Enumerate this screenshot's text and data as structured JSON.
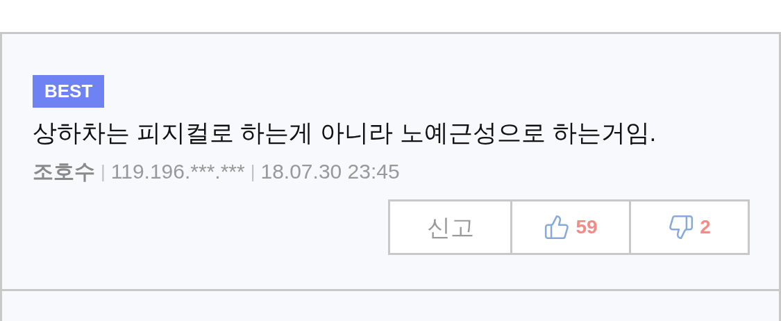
{
  "comment": {
    "badge": "BEST",
    "text": "상하차는 피지컬로 하는게 아니라 노예근성으로 하는거임.",
    "author": "조호수",
    "ip": "119.196.***.***",
    "date": "18.07.30 23:45",
    "separator": "|",
    "actions": [
      {
        "kind": "report",
        "label": "신고"
      },
      {
        "kind": "like",
        "count": "59"
      },
      {
        "kind": "dislike",
        "count": "2"
      }
    ]
  }
}
